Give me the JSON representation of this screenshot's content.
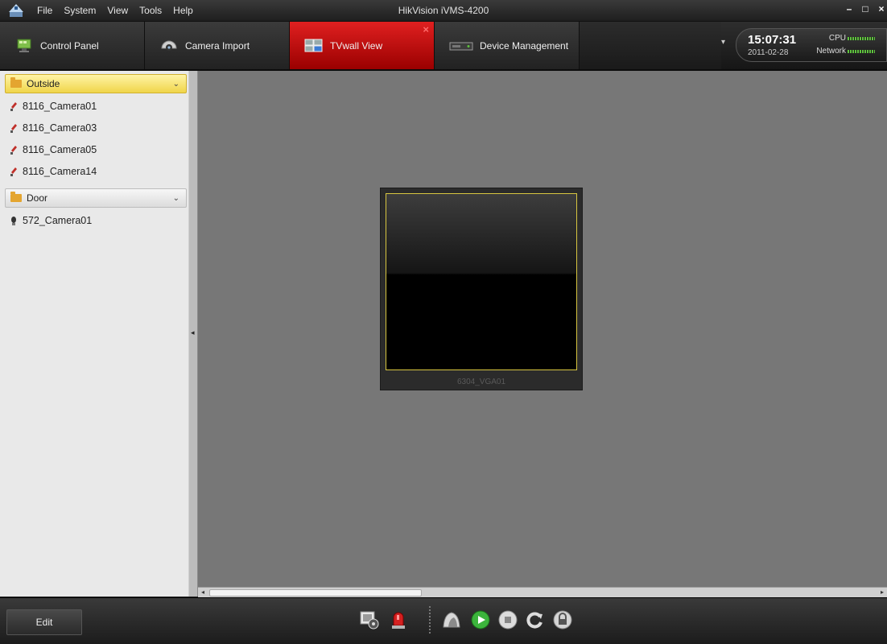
{
  "app": {
    "title": "HikVision iVMS-4200"
  },
  "menu": [
    "File",
    "System",
    "View",
    "Tools",
    "Help"
  ],
  "window_controls": {
    "minimize": "–",
    "maximize": "□",
    "close": "×"
  },
  "tabs": [
    {
      "label": "Control Panel",
      "icon": "control-panel-icon"
    },
    {
      "label": "Camera Import",
      "icon": "camera-import-icon"
    },
    {
      "label": "TVwall View",
      "icon": "tvwall-icon",
      "active": true,
      "close": "×"
    },
    {
      "label": "Device Management",
      "icon": "device-management-icon"
    }
  ],
  "status": {
    "time": "15:07:31",
    "date": "2011-02-28",
    "cpu_label": "CPU",
    "network_label": "Network"
  },
  "tree": {
    "groups": [
      {
        "name": "Outside",
        "chevron": "⌄"
      },
      {
        "name": "Door",
        "chevron": "⌄"
      }
    ],
    "outside_cameras": [
      "8116_Camera01",
      "8116_Camera03",
      "8116_Camera05",
      "8116_Camera14"
    ],
    "door_cameras": [
      "572_Camera01"
    ]
  },
  "splitter": {
    "arrow": "◂"
  },
  "tvwall": {
    "monitor_label": "6304_VGA01"
  },
  "scrollbar": {
    "left_arrow": "◂",
    "right_arrow": "▸"
  },
  "bottom": {
    "edit_label": "Edit",
    "actions": [
      "decode-settings-icon",
      "alarm-icon",
      "scene-icon",
      "play-icon",
      "stop-icon",
      "refresh-icon",
      "lock-icon"
    ]
  },
  "colors": {
    "active_tab": "#c00000",
    "canvas": "#777777",
    "selected_group": "#f0d54a",
    "monitor_border": "#d8c640"
  }
}
